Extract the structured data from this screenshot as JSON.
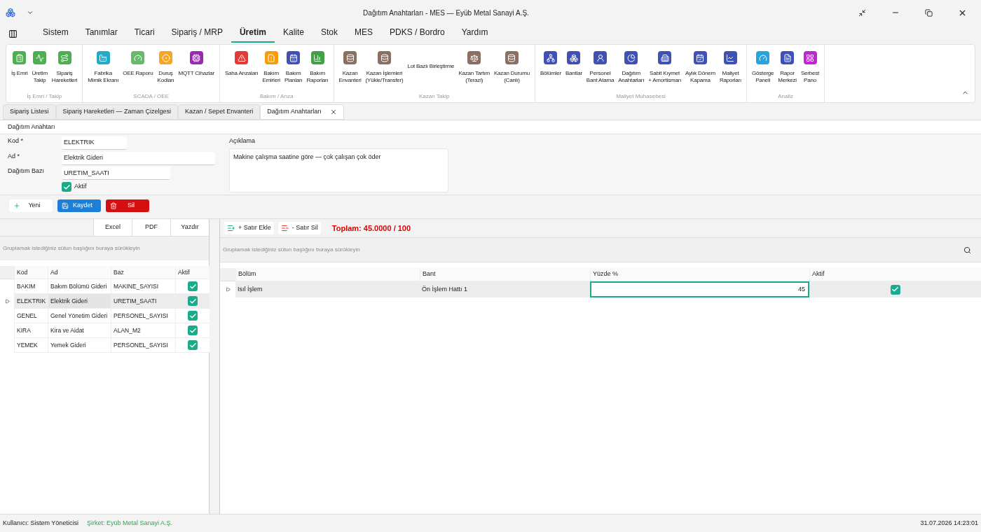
{
  "window": {
    "title": "Dağıtım Anahtarları - MES — Eyüb Metal Sanayi A.Ş."
  },
  "menu_tabs": [
    {
      "label": "Sistem",
      "selected": false
    },
    {
      "label": "Tanımlar",
      "selected": false
    },
    {
      "label": "Ticari",
      "selected": false
    },
    {
      "label": "Sipariş / MRP",
      "selected": false
    },
    {
      "label": "Üretim",
      "selected": true
    },
    {
      "label": "Kalite",
      "selected": false
    },
    {
      "label": "Stok",
      "selected": false
    },
    {
      "label": "MES",
      "selected": false
    },
    {
      "label": "PDKS / Bordro",
      "selected": false
    },
    {
      "label": "Yardım",
      "selected": false
    }
  ],
  "ribbon_groups": [
    {
      "title": "İş Emri / Takip",
      "items": [
        {
          "lines": [
            "İş Emri"
          ],
          "color": "#4caf50"
        },
        {
          "lines": [
            "Üretim",
            "Takip"
          ],
          "color": "#4caf50"
        },
        {
          "lines": [
            "Sipariş",
            "Hareketleri"
          ],
          "color": "#4caf50"
        }
      ]
    },
    {
      "title": "SCADA / OEE",
      "items": [
        {
          "lines": [
            "Fabrika",
            "Mimik Ekranı"
          ],
          "color": "#26a8c8"
        },
        {
          "lines": [
            "OEE Raporu"
          ],
          "color": "#66bb6a"
        },
        {
          "lines": [
            "Duruş",
            "Kodları"
          ],
          "color": "#f5a623"
        },
        {
          "lines": [
            "MQTT Cihazlar"
          ],
          "color": "#9c27b0"
        }
      ]
    },
    {
      "title": "Bakım / Arıza",
      "items": [
        {
          "lines": [
            "Saha Arızaları"
          ],
          "color": "#e53935"
        },
        {
          "lines": [
            "Bakım",
            "Emirleri"
          ],
          "color": "#f59e0b"
        },
        {
          "lines": [
            "Bakım",
            "Planları"
          ],
          "color": "#3f51b5"
        },
        {
          "lines": [
            "Bakım",
            "Raporları"
          ],
          "color": "#43a047"
        }
      ]
    },
    {
      "title": "Kazan Takip",
      "items": [
        {
          "lines": [
            "Kazan",
            "Envanteri"
          ],
          "color": "#8d6e63"
        },
        {
          "lines": [
            "Kazan İşlemleri",
            "(Yükle/Transfer)"
          ],
          "color": "#8d6e63"
        },
        {
          "lines": [
            "Lot Bazlı Birleştirme"
          ]
        },
        {
          "lines": [
            "Kazan Tartım",
            "(Terazi)"
          ],
          "color": "#8d6e63"
        },
        {
          "lines": [
            "Kazan Durumu",
            "(Canlı)"
          ],
          "color": "#8d6e63"
        }
      ]
    },
    {
      "title": "Maliyet Muhasebesi",
      "items": [
        {
          "lines": [
            "Bölümler"
          ],
          "color": "#3f51b5"
        },
        {
          "lines": [
            "Bantlar"
          ],
          "color": "#3f51b5"
        },
        {
          "lines": [
            "Personel",
            "Bant Atama"
          ],
          "color": "#3f51b5"
        },
        {
          "lines": [
            "Dağıtım",
            "Anahtarları"
          ],
          "color": "#3f51b5"
        },
        {
          "lines": [
            "Sabit Kıymet",
            "+ Amortisman"
          ],
          "color": "#3f51b5"
        },
        {
          "lines": [
            "Aylık Dönem",
            "Kapama"
          ],
          "color": "#3f51b5"
        },
        {
          "lines": [
            "Maliyet",
            "Raporları"
          ],
          "color": "#3f51b5"
        }
      ]
    },
    {
      "title": "Analiz",
      "items": [
        {
          "lines": [
            "Gösterge",
            "Paneli"
          ],
          "color": "#29a3e0"
        },
        {
          "lines": [
            "Rapor",
            "Merkezi"
          ],
          "color": "#3f51b5"
        },
        {
          "lines": [
            "Serbest",
            "Pano"
          ],
          "color": "#c026d3"
        }
      ]
    }
  ],
  "doc_tabs": [
    {
      "label": "Sipariş Listesi",
      "selected": false
    },
    {
      "label": "Sipariş Hareketleri — Zaman Çizelgesi",
      "selected": false
    },
    {
      "label": "Kazan / Sepet Envanteri",
      "selected": false
    },
    {
      "label": "Dağıtım Anahtarları",
      "selected": true
    }
  ],
  "form": {
    "title": "Dağıtım Anahtarı",
    "kod_label": "Kod *",
    "kod": "ELEKTRIK",
    "ad_label": "Ad *",
    "ad": "Elektrik Gideri",
    "baz_label": "Dağıtım Bazı",
    "baz": "URETIM_SAATI",
    "aktif_label": "Aktif",
    "aktif": true,
    "aciklama_label": "Açıklama",
    "aciklama": "Makine çalışma saatine göre — çok çalışan çok öder"
  },
  "actions": [
    "Yeni",
    "Kaydet",
    "Sil"
  ],
  "export_buttons": [
    "Excel",
    "PDF",
    "Yazdır"
  ],
  "left_grid": {
    "group_hint": "Gruplamak istediğiniz sütun başlığını buraya sürükleyin",
    "columns": [
      "Kod",
      "Ad",
      "Baz",
      "Aktif"
    ],
    "rows": [
      {
        "kod": "BAKIM",
        "ad": "Bakım Bölümü Gideri",
        "baz": "MAKINE_SAYISI",
        "aktif": true,
        "selected": false
      },
      {
        "kod": "ELEKTRIK",
        "ad": "Elektrik Gideri",
        "baz": "URETIM_SAATI",
        "aktif": true,
        "selected": true
      },
      {
        "kod": "GENEL",
        "ad": "Genel Yönetim Gideri",
        "baz": "PERSONEL_SAYISI",
        "aktif": true,
        "selected": false
      },
      {
        "kod": "KIRA",
        "ad": "Kira ve Aidat",
        "baz": "ALAN_M2",
        "aktif": true,
        "selected": false
      },
      {
        "kod": "YEMEK",
        "ad": "Yemek Gideri",
        "baz": "PERSONEL_SAYISI",
        "aktif": true,
        "selected": false
      }
    ]
  },
  "right_toolbar": {
    "add": "+ Satır Ekle",
    "remove": "- Satır Sil",
    "total": "Toplam: 45.0000 / 100"
  },
  "right_grid": {
    "group_hint": "Gruplamak istediğiniz sütun başlığını buraya sürükleyin",
    "columns": [
      "Bölüm",
      "Bant",
      "Yüzde %",
      "Aktif"
    ],
    "rows": [
      {
        "bolum": "Isıl İşlem",
        "bant": "Ön İşlem Hattı 1",
        "yuzde": "45",
        "aktif": true,
        "selected": true
      }
    ]
  },
  "status_bar": {
    "user": "Kullanıcı: Sistem Yöneticisi",
    "company": "Şirket: Eyüb Metal Sanayi A.Ş.",
    "datetime": "31.07.2026 14:23:01"
  }
}
